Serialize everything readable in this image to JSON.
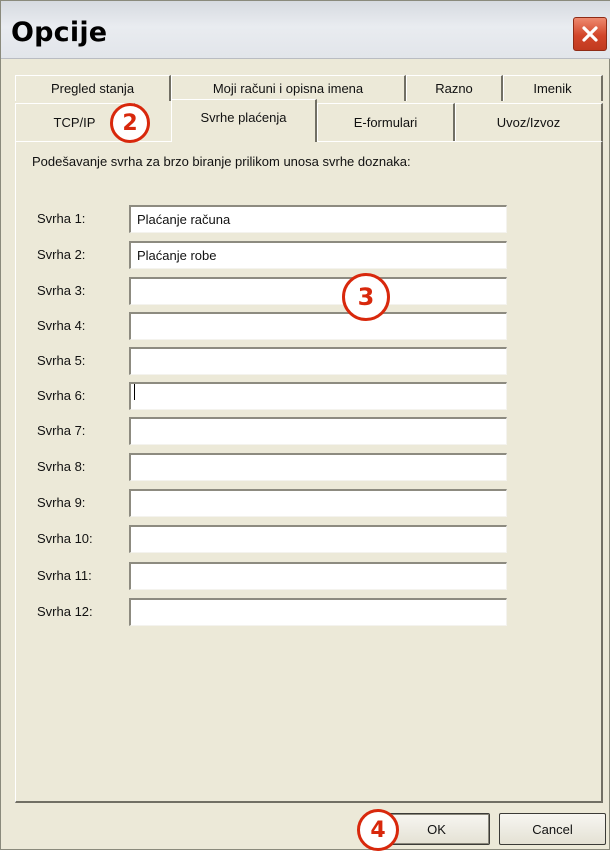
{
  "window": {
    "title": "Opcije",
    "close_icon": "close-icon"
  },
  "tabs": {
    "row1": [
      "Pregled stanja",
      "Moji računi i opisna imena",
      "Razno",
      "Imenik"
    ],
    "row2": [
      "TCP/IP",
      "Svrhe plaćenja",
      "E-formulari",
      "Uvoz/Izvoz"
    ],
    "active": "Svrhe plaćenja"
  },
  "panel": {
    "description": "Podešavanje svrha za brzo biranje prilikom unosa svrhe doznaka:",
    "fields": [
      {
        "label": "Svrha 1:",
        "value": "Plaćanje računa"
      },
      {
        "label": "Svrha 2:",
        "value": "Plaćanje robe"
      },
      {
        "label": "Svrha 3:",
        "value": ""
      },
      {
        "label": "Svrha 4:",
        "value": ""
      },
      {
        "label": "Svrha 5:",
        "value": ""
      },
      {
        "label": "Svrha 6:",
        "value": ""
      },
      {
        "label": "Svrha 7:",
        "value": ""
      },
      {
        "label": "Svrha 8:",
        "value": ""
      },
      {
        "label": "Svrha 9:",
        "value": ""
      },
      {
        "label": "Svrha 10:",
        "value": ""
      },
      {
        "label": "Svrha 11:",
        "value": ""
      },
      {
        "label": "Svrha 12:",
        "value": ""
      }
    ]
  },
  "buttons": {
    "ok": "OK",
    "cancel": "Cancel"
  },
  "markers": [
    "2",
    "3",
    "4"
  ],
  "colors": {
    "marker": "#d8280c",
    "window_bg": "#ece9d8",
    "close_button": "#d2462a"
  }
}
